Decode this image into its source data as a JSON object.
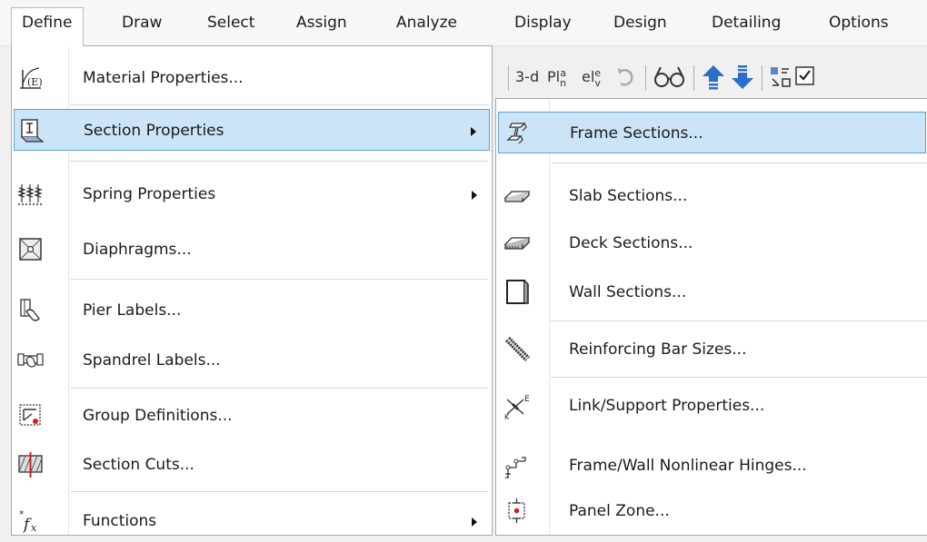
{
  "menubar": {
    "items": [
      "Define",
      "Draw",
      "Select",
      "Assign",
      "Analyze",
      "Display",
      "Design",
      "Detailing",
      "Options"
    ]
  },
  "toolbar": {
    "view_3d": "3-d",
    "plan": "Pl",
    "plan_super": "a",
    "plan_sub": "n",
    "elev": "el",
    "elev_super": "e",
    "elev_sub": "v"
  },
  "define_menu": {
    "items": [
      {
        "label": "Material Properties...",
        "icon": "material-properties-icon",
        "submenu": false
      },
      {
        "label": "Section Properties",
        "icon": "section-properties-icon",
        "submenu": true,
        "highlighted": true
      },
      {
        "label": "Spring Properties",
        "icon": "spring-properties-icon",
        "submenu": true
      },
      {
        "label": "Diaphragms...",
        "icon": "diaphragm-icon",
        "submenu": false
      },
      {
        "label": "Pier Labels...",
        "icon": "pier-label-icon",
        "submenu": false
      },
      {
        "label": "Spandrel Labels...",
        "icon": "spandrel-label-icon",
        "submenu": false
      },
      {
        "label": "Group Definitions...",
        "icon": "group-definitions-icon",
        "submenu": false
      },
      {
        "label": "Section Cuts...",
        "icon": "section-cuts-icon",
        "submenu": false
      },
      {
        "label": "Functions",
        "icon": "functions-icon",
        "submenu": true
      }
    ]
  },
  "section_submenu": {
    "items": [
      {
        "label": "Frame Sections...",
        "icon": "frame-section-icon",
        "highlighted": true
      },
      {
        "label": "Slab Sections...",
        "icon": "slab-section-icon"
      },
      {
        "label": "Deck Sections...",
        "icon": "deck-section-icon"
      },
      {
        "label": "Wall Sections...",
        "icon": "wall-section-icon"
      },
      {
        "label": "Reinforcing Bar Sizes...",
        "icon": "rebar-icon"
      },
      {
        "label": "Link/Support Properties...",
        "icon": "link-support-icon"
      },
      {
        "label": "Frame/Wall Nonlinear Hinges...",
        "icon": "nonlinear-hinge-icon"
      },
      {
        "label": "Panel Zone...",
        "icon": "panel-zone-icon"
      }
    ]
  },
  "colors": {
    "highlight_bg": "#cce4f7",
    "highlight_border": "#5aa0d8",
    "arrow_blue": "#2a6fc9"
  }
}
